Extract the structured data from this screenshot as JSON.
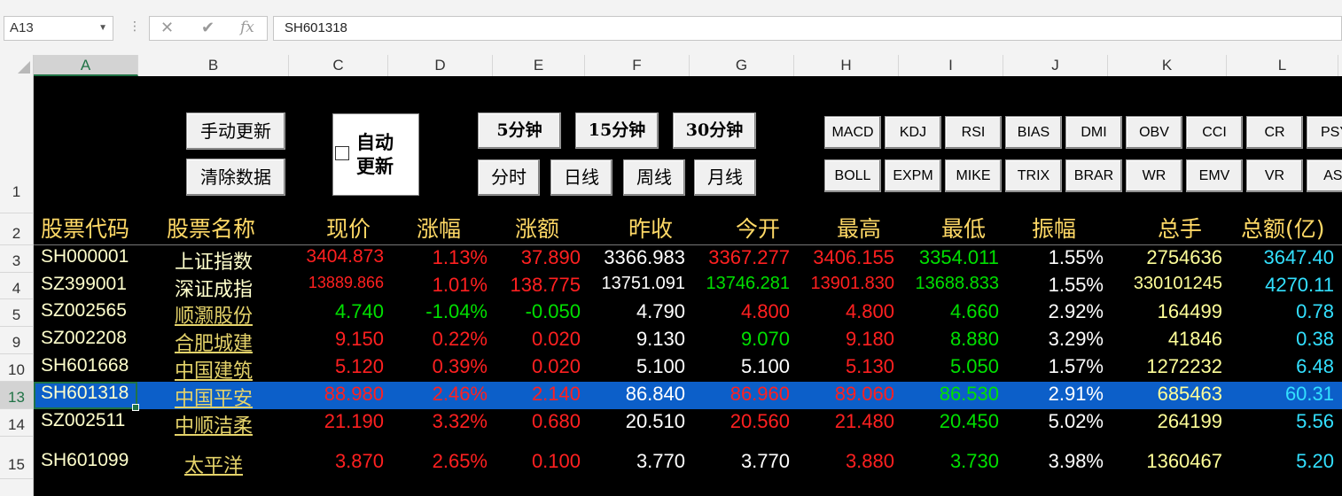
{
  "formula_bar": {
    "name_box": "A13",
    "formula": "SH601318",
    "cancel_icon": "✕",
    "enter_icon": "✔",
    "fx_icon": "fx"
  },
  "columns": [
    "A",
    "B",
    "C",
    "D",
    "E",
    "F",
    "G",
    "H",
    "I",
    "J",
    "K",
    "L"
  ],
  "rows": [
    "1",
    "2",
    "3",
    "4",
    "5",
    "9",
    "10",
    "13",
    "14",
    "15"
  ],
  "buttons": {
    "manual_update": "手动更新",
    "clear_data": "清除数据",
    "auto_update": "自动更新",
    "min5": "5分钟",
    "min15": "15分钟",
    "min30": "30分钟",
    "timeshare": "分时",
    "daily": "日线",
    "weekly": "周线",
    "monthly": "月线"
  },
  "indicators_row1": [
    "MACD",
    "KDJ",
    "RSI",
    "BIAS",
    "DMI",
    "OBV",
    "CCI",
    "CR",
    "PSY"
  ],
  "indicators_row2": [
    "BOLL",
    "EXPM",
    "MIKE",
    "TRIX",
    "BRAR",
    "WR",
    "EMV",
    "VR",
    "ASI"
  ],
  "headers": [
    "股票代码",
    "股票名称",
    "现价",
    "涨幅",
    "涨额",
    "昨收",
    "今开",
    "最高",
    "最低",
    "振幅",
    "总手",
    "总额(亿)"
  ],
  "stocks": [
    {
      "code": "SH000001",
      "name": "上证指数",
      "price": "3404.873",
      "pct": "1.13%",
      "chg": "37.890",
      "prev": "3366.983",
      "open": "3367.277",
      "high": "3406.155",
      "low": "3354.011",
      "amp": "1.55%",
      "vol": "2754636",
      "amt": "3647.40"
    },
    {
      "code": "SZ399001",
      "name": "深证成指",
      "price": "13889.866",
      "pct": "1.01%",
      "chg": "138.775",
      "prev": "13751.091",
      "open": "13746.281",
      "high": "13901.830",
      "low": "13688.833",
      "amp": "1.55%",
      "vol": "330101245",
      "amt": "4270.11"
    },
    {
      "code": "SZ002565",
      "name": "顺灏股份",
      "price": "4.740",
      "pct": "-1.04%",
      "chg": "-0.050",
      "prev": "4.790",
      "open": "4.800",
      "high": "4.800",
      "low": "4.660",
      "amp": "2.92%",
      "vol": "164499",
      "amt": "0.78"
    },
    {
      "code": "SZ002208",
      "name": "合肥城建",
      "price": "9.150",
      "pct": "0.22%",
      "chg": "0.020",
      "prev": "9.130",
      "open": "9.070",
      "high": "9.180",
      "low": "8.880",
      "amp": "3.29%",
      "vol": "41846",
      "amt": "0.38"
    },
    {
      "code": "SH601668",
      "name": "中国建筑",
      "price": "5.120",
      "pct": "0.39%",
      "chg": "0.020",
      "prev": "5.100",
      "open": "5.100",
      "high": "5.130",
      "low": "5.050",
      "amp": "1.57%",
      "vol": "1272232",
      "amt": "6.48"
    },
    {
      "code": "SH601318",
      "name": "中国平安",
      "price": "88.980",
      "pct": "2.46%",
      "chg": "2.140",
      "prev": "86.840",
      "open": "86.960",
      "high": "89.060",
      "low": "86.530",
      "amp": "2.91%",
      "vol": "685463",
      "amt": "60.31"
    },
    {
      "code": "SZ002511",
      "name": "中顺洁柔",
      "price": "21.190",
      "pct": "3.32%",
      "chg": "0.680",
      "prev": "20.510",
      "open": "20.560",
      "high": "21.480",
      "low": "20.450",
      "amp": "5.02%",
      "vol": "264199",
      "amt": "5.56"
    },
    {
      "code": "SH601099",
      "name": "太平洋",
      "price": "3.870",
      "pct": "2.65%",
      "chg": "0.100",
      "prev": "3.770",
      "open": "3.770",
      "high": "3.880",
      "low": "3.730",
      "amp": "3.98%",
      "vol": "1360467",
      "amt": "5.20"
    }
  ],
  "colors": {
    "up": "#ff2020",
    "down": "#00e000",
    "neutral": "#ffffff",
    "volume": "#ffff99",
    "amount": "#33e0ff",
    "header": "#ffd966",
    "selection": "#0c5fc9"
  }
}
